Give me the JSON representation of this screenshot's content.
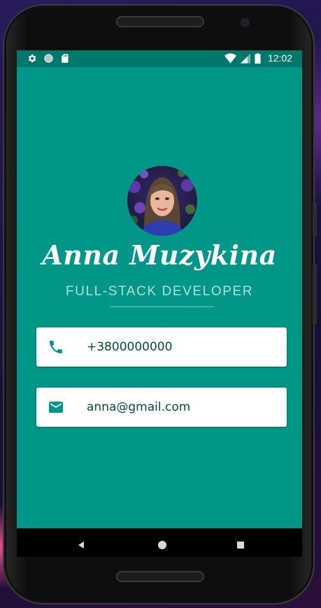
{
  "statusbar": {
    "time": "12:02",
    "icons_left": [
      "settings-icon",
      "circle-icon",
      "sd-card-icon"
    ],
    "icons_right": [
      "wifi-icon",
      "signal-icon",
      "battery-icon"
    ]
  },
  "profile": {
    "name": "Anna Muzykina",
    "title": "FULL-STACK DEVELOPER",
    "avatar": "profile-photo"
  },
  "contacts": {
    "phone": {
      "icon": "phone-icon",
      "value": "+3800000000"
    },
    "email": {
      "icon": "email-icon",
      "value": "anna@gmail.com"
    }
  },
  "navbar": {
    "buttons": [
      "back-icon",
      "home-icon",
      "recents-icon"
    ]
  },
  "colors": {
    "primary": "#009688",
    "primary_dark": "#00796b",
    "card_text": "#004d40",
    "title_text": "#b2dfdb",
    "icon": "#009688"
  }
}
